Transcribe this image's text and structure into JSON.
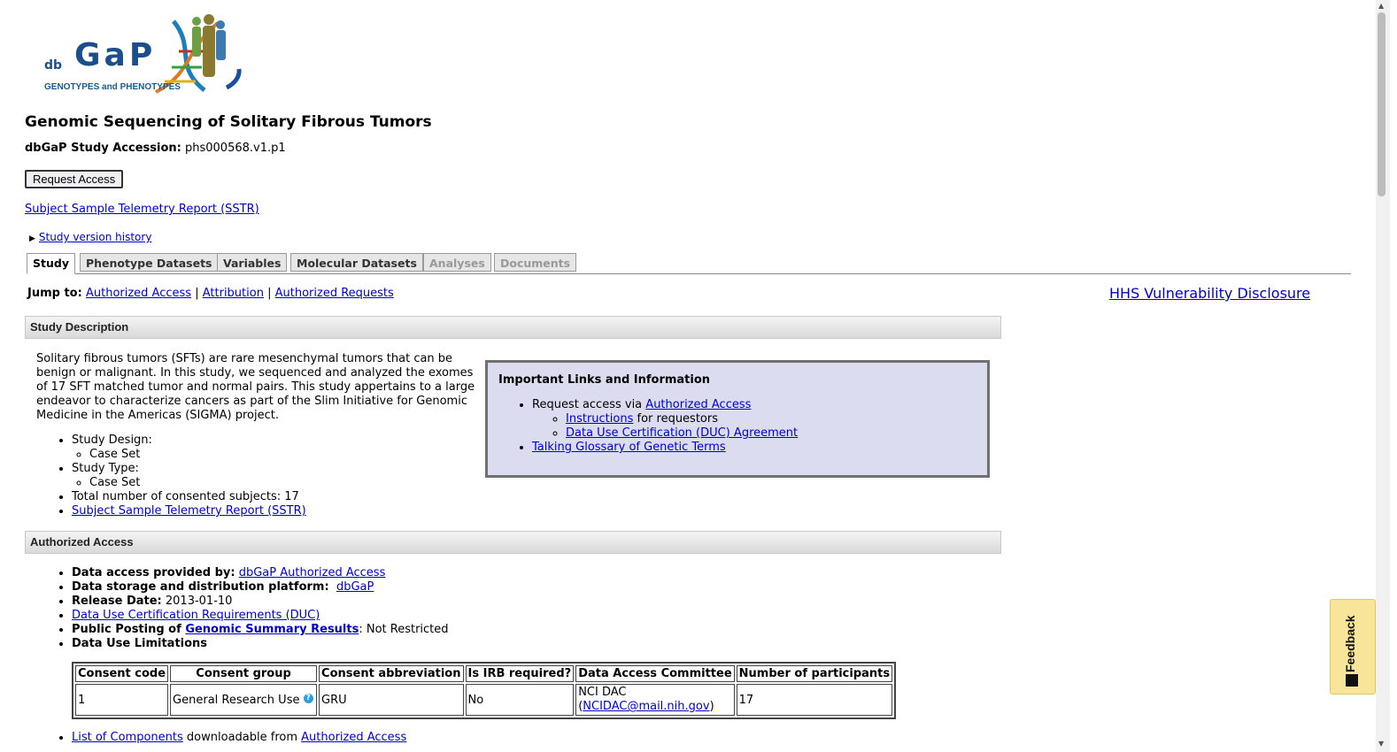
{
  "logo": {
    "main": "GaP",
    "prefix": "db",
    "tagline": "GENOTYPES and PHENOTYPES"
  },
  "page": {
    "title": "Genomic Sequencing of Solitary Fibrous Tumors",
    "accession_label": "dbGaP Study Accession:",
    "accession_value": "phs000568.v1.p1",
    "request_access": "Request Access",
    "sstr_link": "Subject Sample Telemetry Report (SSTR)",
    "version_history": "Study version history"
  },
  "tabs": [
    {
      "label": "Study",
      "state": "active"
    },
    {
      "label": "Phenotype Datasets",
      "state": "normal"
    },
    {
      "label": "Variables",
      "state": "normal"
    },
    {
      "label": "Molecular Datasets",
      "state": "normal"
    },
    {
      "label": "Analyses",
      "state": "disabled"
    },
    {
      "label": "Documents",
      "state": "disabled"
    }
  ],
  "jump": {
    "label": "Jump to:",
    "links": [
      "Authorized Access",
      "Attribution",
      "Authorized Requests"
    ],
    "separator": "|"
  },
  "hhs_link": "HHS Vulnerability Disclosure",
  "study_description": {
    "header": "Study Description",
    "text": "Solitary fibrous tumors (SFTs) are rare mesenchymal tumors that can be benign or malignant. In this study, we sequenced and analyzed the exomes of 17 SFT matched tumor and normal pairs. This study appertains to a large endeavor to characterize cancers as part of the Slim Initiative for Genomic Medicine in the Americas (SIGMA) project.",
    "design_label": "Study Design:",
    "design_value": "Case Set",
    "type_label": "Study Type:",
    "type_value": "Case Set",
    "subjects": "Total number of consented subjects: 17",
    "sstr_link": "Subject Sample Telemetry Report (SSTR)"
  },
  "infobox": {
    "title": "Important Links and Information",
    "request_prefix": "Request access via",
    "request_link": "Authorized Access",
    "instructions_link": "Instructions",
    "instructions_suffix": "for requestors",
    "duc_link": "Data Use Certification (DUC) Agreement",
    "glossary_link": "Talking Glossary of Genetic Terms"
  },
  "authorized_access": {
    "header": "Authorized Access",
    "provided_label": "Data access provided by:",
    "provided_link": "dbGaP Authorized Access",
    "platform_label": "Data storage and distribution platform:",
    "platform_link": "dbGaP",
    "release_label": "Release Date:",
    "release_value": "2013-01-10",
    "duc_link": "Data Use Certification Requirements (DUC)",
    "posting_label": "Public Posting of",
    "posting_link": "Genomic Summary Results",
    "posting_value": ": Not Restricted",
    "limitations_label": "Data Use Limitations"
  },
  "consent_table": {
    "headers": [
      "Consent code",
      "Consent group",
      "Consent abbreviation",
      "Is IRB required?",
      "Data Access Committee",
      "Number of participants"
    ],
    "row": {
      "code": "1",
      "group": "General Research Use",
      "abbreviation": "GRU",
      "irb": "No",
      "dac": "NCI DAC",
      "dac_open": "(",
      "dac_email": "NCIDAC@mail.nih.gov",
      "dac_close": ")",
      "participants": "17"
    }
  },
  "components": {
    "link": "List of Components",
    "middle": "downloadable from",
    "link2": "Authorized Access"
  },
  "feedback": "Feedback"
}
